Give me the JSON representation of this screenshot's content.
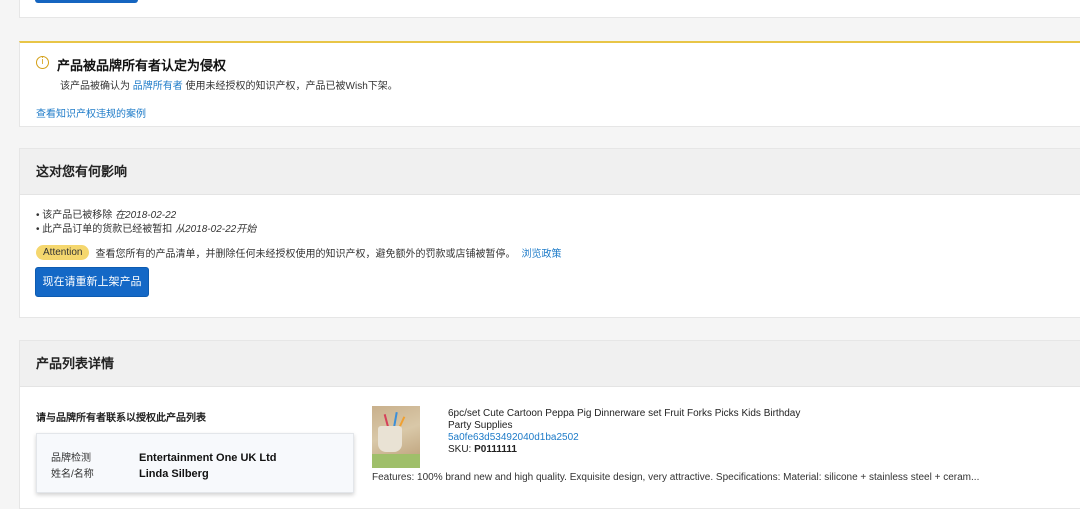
{
  "alert": {
    "icon": "info-circle-icon",
    "title": "产品被品牌所有者认定为侵权",
    "desc_before": "该产品被确认为 ",
    "desc_link": "品牌所有者",
    "desc_after": " 使用未经授权的知识产权，产品已被Wish下架。",
    "link": "查看知识产权违规的案例"
  },
  "impact": {
    "title": "这对您有何影响",
    "bullet1_text": "该产品已被移除 ",
    "bullet1_date": "在2018-02-22",
    "bullet2_text": "此产品订单的货款已经被暂扣 ",
    "bullet2_date": "从2018-02-22开始",
    "attention_badge": "Attention",
    "attention_text": "查看您所有的产品清单，并删除任何未经授权使用的知识产权，避免额外的罚款或店铺被暂停。",
    "policy_link": "浏览政策",
    "relist_button": "现在请重新上架产品"
  },
  "details": {
    "title": "产品列表详情",
    "contact_title": "请与品牌所有者联系以授权此产品列表",
    "owner_brand_label": "品牌检测",
    "owner_brand_value": "Entertainment One UK Ltd",
    "owner_name_label": "姓名/名称",
    "owner_name_value": "Linda Silberg",
    "product_title_line1": "6pc/set Cute Cartoon Peppa Pig Dinnerware set Fruit Forks Picks Kids Birthday",
    "product_title_line2": "Party Supplies",
    "product_id": "5a0fe63d53492040d1ba2502",
    "sku_label": "SKU: ",
    "sku_value": "P0111111",
    "features": "Features: 100% brand new and high quality. Exquisite design, very attractive. Specifications: Material: silicone + stainless  steel + ceram..."
  },
  "colors": {
    "primary_button": "#1468c6",
    "link": "#1e7bc8",
    "alert_border": "#e8c547",
    "attention_badge": "#f5d76e"
  }
}
